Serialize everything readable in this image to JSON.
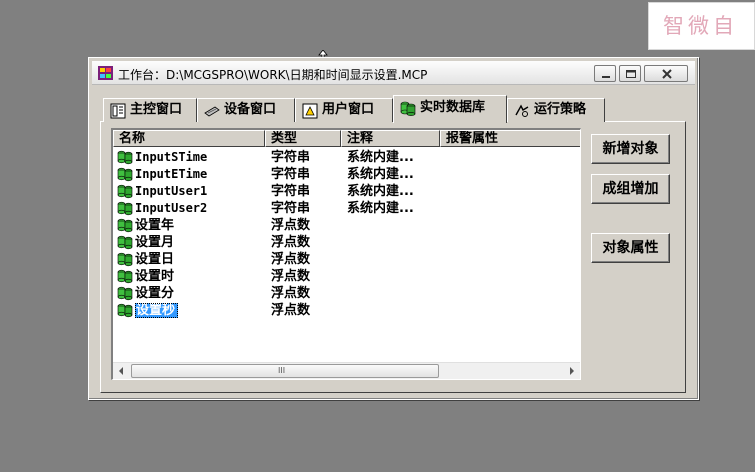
{
  "watermark": {
    "text": "智微自"
  },
  "window": {
    "title": "工作台：D:\\MCGSPRO\\WORK\\日期和时间显示设置.MCP"
  },
  "tabs": [
    {
      "label": "主控窗口",
      "icon": "main-window-icon"
    },
    {
      "label": "设备窗口",
      "icon": "device-icon"
    },
    {
      "label": "用户窗口",
      "icon": "user-window-icon"
    },
    {
      "label": "实时数据库",
      "icon": "database-icon",
      "active": true
    },
    {
      "label": "运行策略",
      "icon": "strategy-icon"
    }
  ],
  "list": {
    "columns": [
      "名称",
      "类型",
      "注释",
      "报警属性"
    ],
    "rows": [
      {
        "name": "InputSTime",
        "type": "字符串",
        "note": "系统内建..."
      },
      {
        "name": "InputETime",
        "type": "字符串",
        "note": "系统内建..."
      },
      {
        "name": "InputUser1",
        "type": "字符串",
        "note": "系统内建..."
      },
      {
        "name": "InputUser2",
        "type": "字符串",
        "note": "系统内建..."
      },
      {
        "name": "设置年",
        "type": "浮点数",
        "note": ""
      },
      {
        "name": "设置月",
        "type": "浮点数",
        "note": ""
      },
      {
        "name": "设置日",
        "type": "浮点数",
        "note": ""
      },
      {
        "name": "设置时",
        "type": "浮点数",
        "note": ""
      },
      {
        "name": "设置分",
        "type": "浮点数",
        "note": ""
      },
      {
        "name": "设置秒",
        "type": "浮点数",
        "note": "",
        "selected": true
      }
    ],
    "scrollbar_grip": "III"
  },
  "buttons": {
    "new_object": "新增对象",
    "group_add": "成组增加",
    "object_props": "对象属性"
  },
  "colors": {
    "desktop": "#808080",
    "face": "#d4d0c8",
    "selection": "#3399ff"
  }
}
